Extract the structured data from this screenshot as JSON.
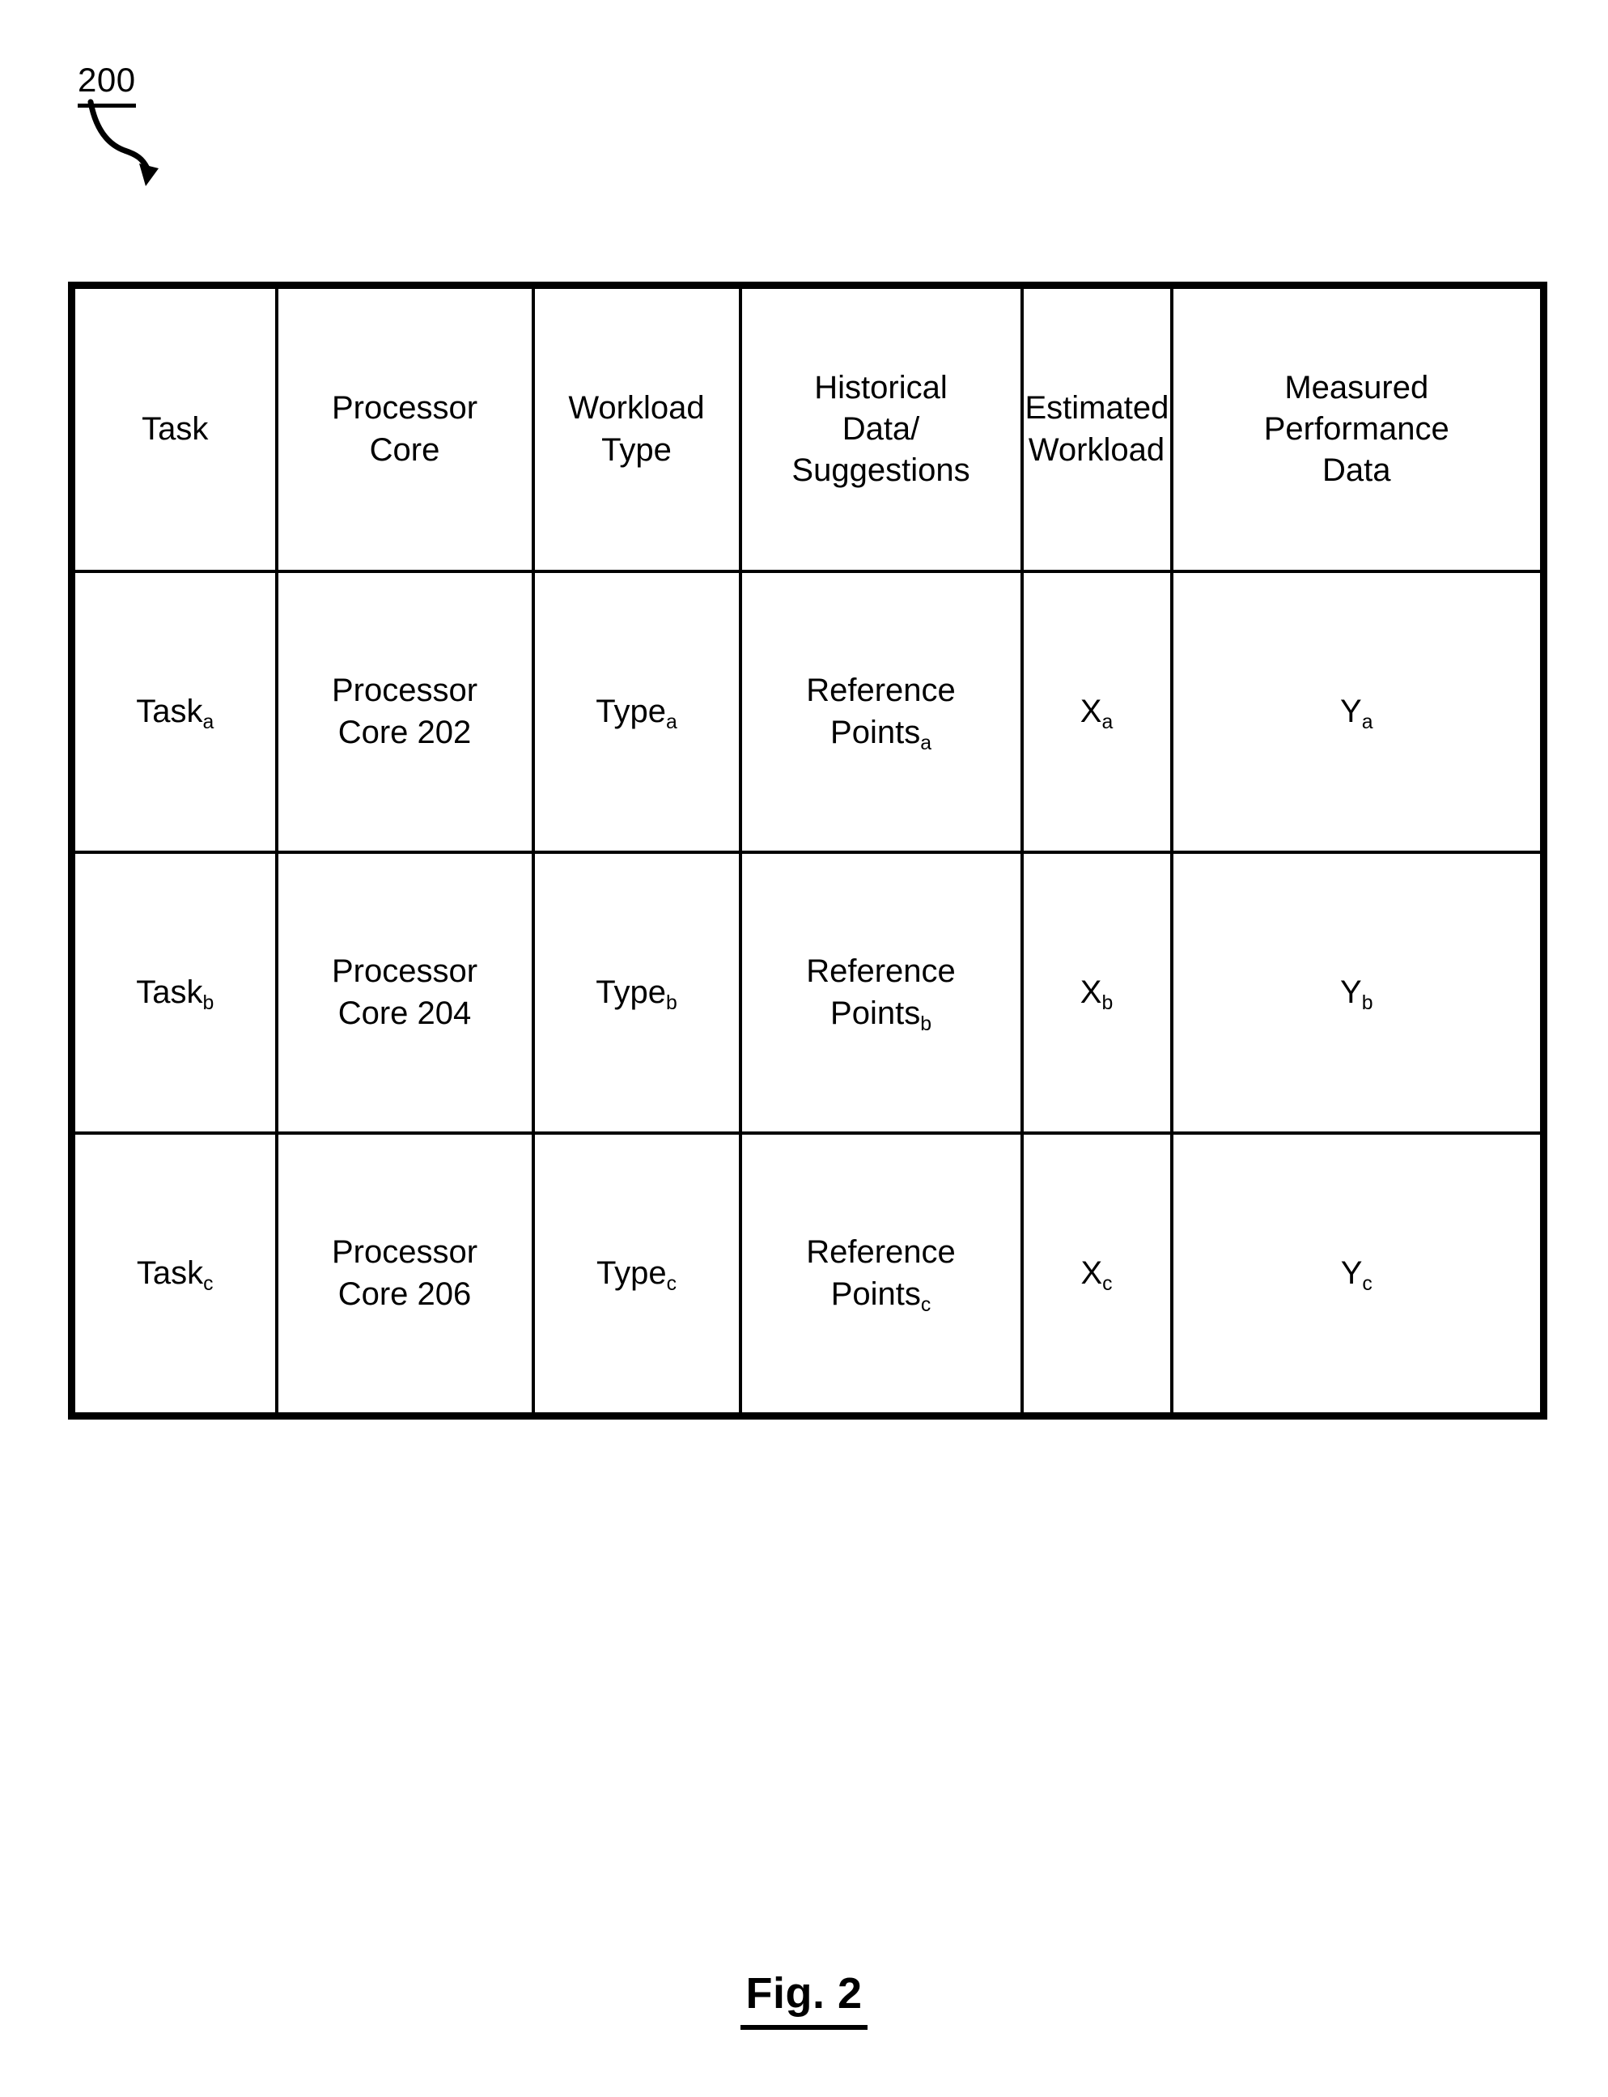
{
  "figure": {
    "reference_number": "200",
    "caption": "Fig. 2",
    "arrow_icon": "curved-arrow-icon"
  },
  "table": {
    "columns": [
      {
        "key": "task",
        "header_lines": [
          "Task"
        ]
      },
      {
        "key": "core",
        "header_lines": [
          "Processor",
          "Core"
        ]
      },
      {
        "key": "type",
        "header_lines": [
          "Workload",
          "Type"
        ]
      },
      {
        "key": "hist",
        "header_lines": [
          "Historical",
          "Data/",
          "Suggestions"
        ]
      },
      {
        "key": "est",
        "header_lines": [
          "Estimated",
          "Workload"
        ]
      },
      {
        "key": "meas",
        "header_lines": [
          "Measured",
          "Performance",
          "Data"
        ]
      }
    ],
    "header": {
      "task": "Task",
      "core_line1": "Processor",
      "core_line2": "Core",
      "type_line1": "Workload",
      "type_line2": "Type",
      "hist_line1": "Historical",
      "hist_line2": "Data/",
      "hist_line3": "Suggestions",
      "est_line1": "Estimated",
      "est_line2": "Workload",
      "meas_line1": "Measured",
      "meas_line2": "Performance",
      "meas_line3": "Data"
    },
    "rows": [
      {
        "task_base": "Task",
        "task_sub": "a",
        "core_line1": "Processor",
        "core_line2": "Core 202",
        "type_base": "Type",
        "type_sub": "a",
        "hist_line1": "Reference",
        "hist_line2_base": "Points",
        "hist_line2_sub": "a",
        "est_base": "X",
        "est_sub": "a",
        "meas_base": "Y",
        "meas_sub": "a"
      },
      {
        "task_base": "Task",
        "task_sub": "b",
        "core_line1": "Processor",
        "core_line2": "Core 204",
        "type_base": "Type",
        "type_sub": "b",
        "hist_line1": "Reference",
        "hist_line2_base": "Points",
        "hist_line2_sub": "b",
        "est_base": "X",
        "est_sub": "b",
        "meas_base": "Y",
        "meas_sub": "b"
      },
      {
        "task_base": "Task",
        "task_sub": "c",
        "core_line1": "Processor",
        "core_line2": "Core 206",
        "type_base": "Type",
        "type_sub": "c",
        "hist_line1": "Reference",
        "hist_line2_base": "Points",
        "hist_line2_sub": "c",
        "est_base": "X",
        "est_sub": "c",
        "meas_base": "Y",
        "meas_sub": "c"
      }
    ]
  },
  "colors": {
    "ink": "#000000",
    "paper": "#ffffff"
  }
}
